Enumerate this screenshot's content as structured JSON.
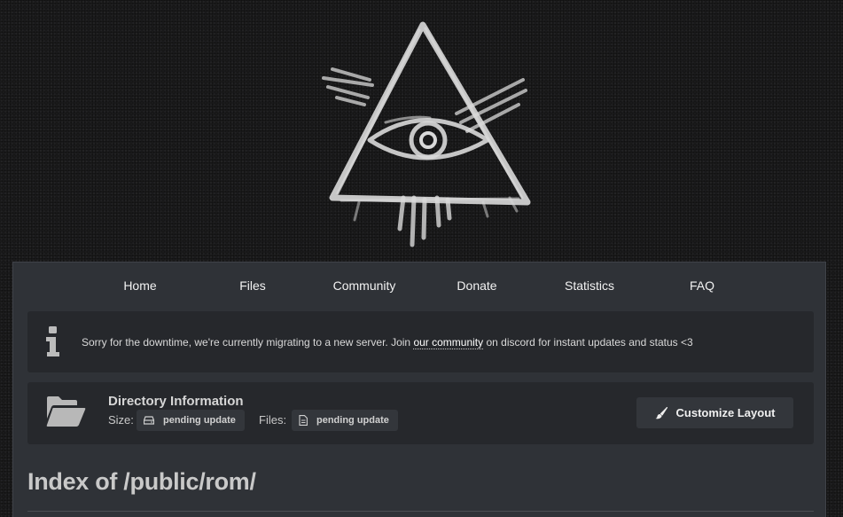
{
  "nav": {
    "items": [
      {
        "label": "Home"
      },
      {
        "label": "Files"
      },
      {
        "label": "Community"
      },
      {
        "label": "Donate"
      },
      {
        "label": "Statistics"
      },
      {
        "label": "FAQ"
      }
    ]
  },
  "notice": {
    "icon": "info-icon",
    "text_before": "Sorry for the downtime, we're currently migrating to a new server. Join ",
    "link_text": "our community",
    "text_after": " on discord for instant updates and status <3"
  },
  "directory": {
    "icon": "open-folder-icon",
    "title": "Directory Information",
    "size_label": "Size:",
    "size_icon": "hard-drive-icon",
    "size_value": "pending update",
    "files_label": "Files:",
    "files_icon": "file-icon",
    "files_value": "pending update",
    "customize_icon": "paintbrush-icon",
    "customize_label": "Customize Layout"
  },
  "page": {
    "heading": "Index of /public/rom/"
  },
  "colors": {
    "background": "#1a1a1b",
    "panel": "#2f3237",
    "card": "#26282c",
    "chip": "#33363b",
    "text": "#f2f2f2"
  }
}
